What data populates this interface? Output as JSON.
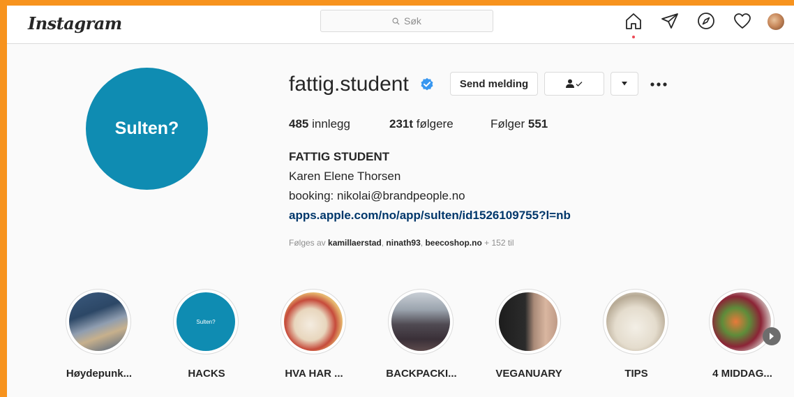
{
  "app": {
    "logo": "Instagram"
  },
  "search": {
    "placeholder": "Søk"
  },
  "nav": {
    "icons": [
      "home-icon",
      "direct-send-icon",
      "explore-compass-icon",
      "activity-heart-icon",
      "profile-avatar"
    ]
  },
  "profile": {
    "avatar_text": "Sulten?",
    "username": "fattig.student",
    "verified": true,
    "buttons": {
      "message": "Send melding",
      "follow_state_icon": "person-check-icon",
      "dropdown_icon": "chevron-down-icon",
      "more_icon": "more-dots-icon"
    },
    "stats": {
      "posts_count": "485",
      "posts_label": "innlegg",
      "followers_count": "231t",
      "followers_label": "følgere",
      "following_label": "Følger",
      "following_count": "551"
    },
    "bio": {
      "full_name": "FATTIG STUDENT",
      "line1": "Karen Elene Thorsen",
      "line2": "booking: nikolai@brandpeople.no",
      "link": "apps.apple.com/no/app/sulten/id1526109755?l=nb"
    },
    "followed_by": {
      "prefix": "Følges av",
      "user1": "kamillaerstad",
      "user2": "ninath93",
      "user3": "beecoshop.no",
      "suffix": "+ 152 til"
    }
  },
  "highlights": [
    {
      "label": "Høydepunk..."
    },
    {
      "label": "HACKS",
      "cover_text": "Sulten?"
    },
    {
      "label": "HVA HAR ..."
    },
    {
      "label": "BACKPACKI..."
    },
    {
      "label": "VEGANUARY"
    },
    {
      "label": "TIPS"
    },
    {
      "label": "4 MIDDAG..."
    }
  ],
  "colors": {
    "accent_orange": "#f7931e",
    "brand_teal": "#0f8cb2",
    "verified_blue": "#3897f0",
    "link": "#00376b"
  }
}
